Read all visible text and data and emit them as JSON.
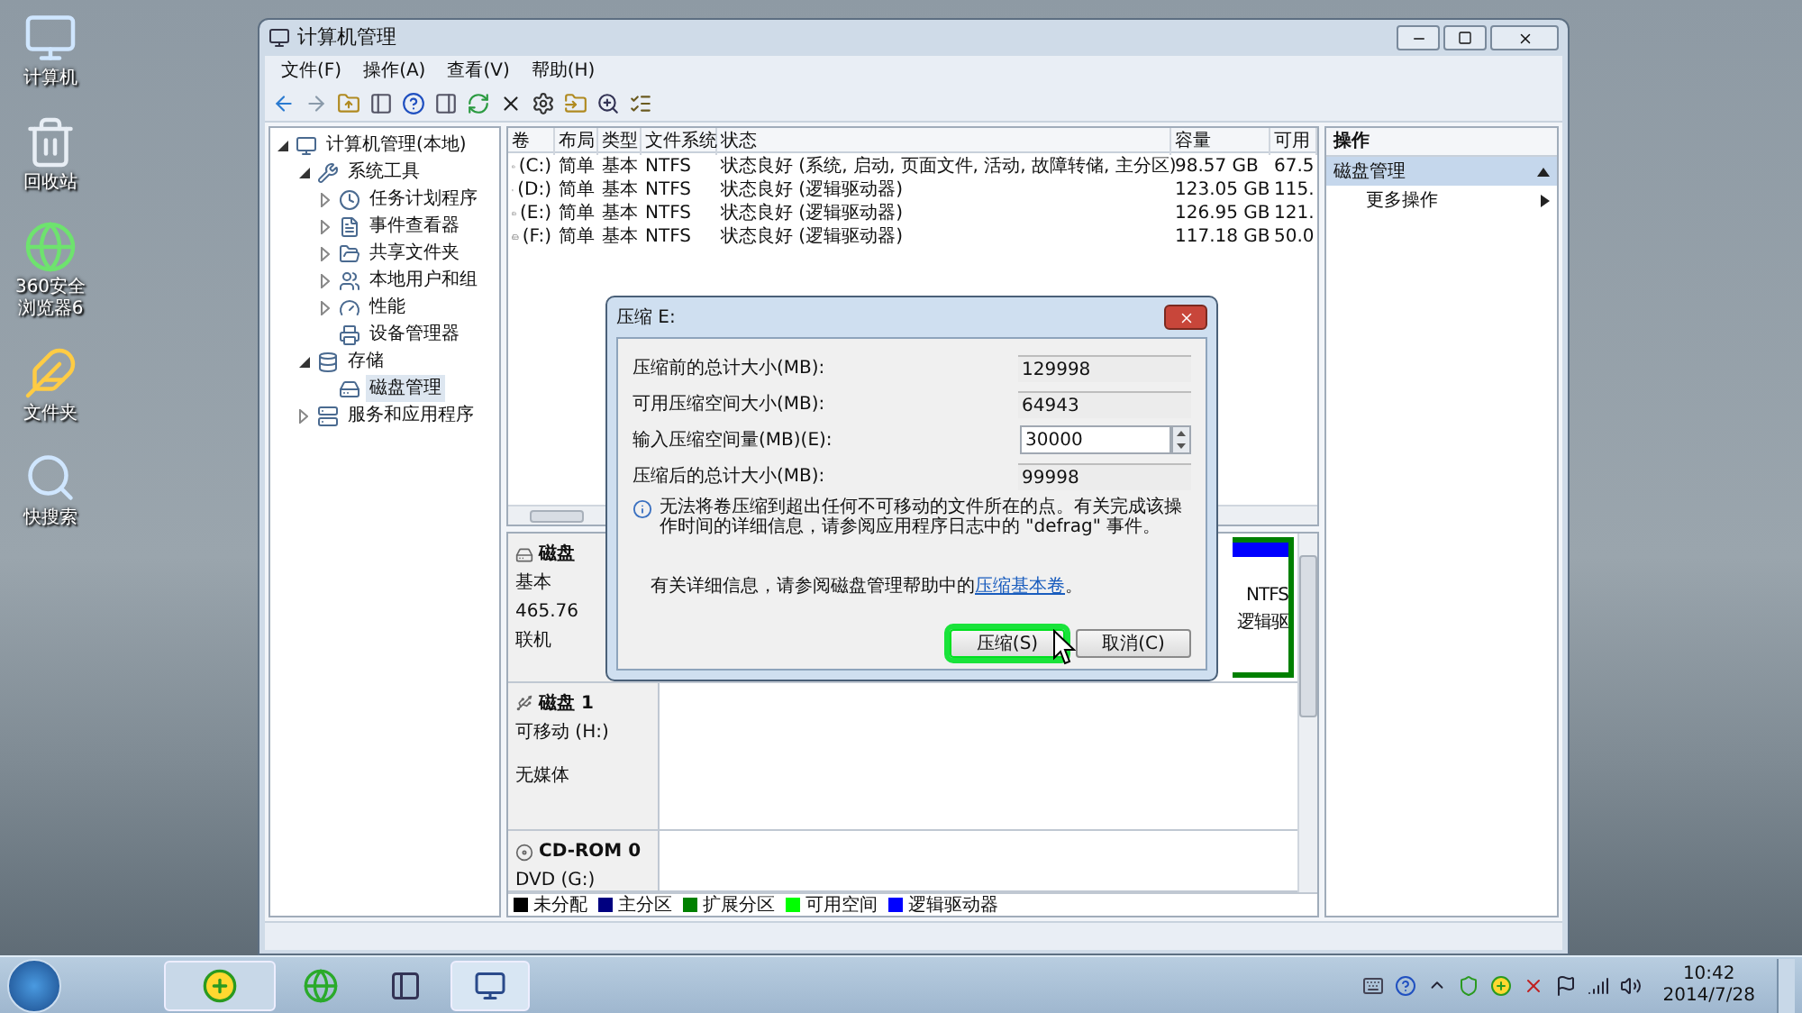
{
  "desktop_icons": [
    {
      "kind": "computer",
      "label": "计算机"
    },
    {
      "kind": "recycle",
      "label": "回收站"
    },
    {
      "kind": "browser",
      "label": "360安全浏览器6"
    },
    {
      "kind": "butterfly",
      "label": "文件夹"
    },
    {
      "kind": "search",
      "label": "快搜索"
    }
  ],
  "window": {
    "title": "计算机管理"
  },
  "menu": [
    "文件(F)",
    "操作(A)",
    "查看(V)",
    "帮助(H)"
  ],
  "tree": [
    {
      "kind": "computer",
      "label": "计算机管理(本地)",
      "expanded": true,
      "selected": false,
      "children": [
        {
          "kind": "tools",
          "label": "系统工具",
          "expanded": true,
          "selected": false,
          "children": [
            {
              "kind": "clock",
              "label": "任务计划程序",
              "expanded": false,
              "selected": false
            },
            {
              "kind": "log",
              "label": "事件查看器",
              "expanded": false,
              "selected": false
            },
            {
              "kind": "share",
              "label": "共享文件夹",
              "expanded": false,
              "selected": false
            },
            {
              "kind": "users",
              "label": "本地用户和组",
              "expanded": false,
              "selected": false
            },
            {
              "kind": "performance",
              "label": "性能",
              "expanded": false,
              "selected": false
            },
            {
              "kind": "devices",
              "label": "设备管理器",
              "selected": false
            }
          ]
        },
        {
          "kind": "storage",
          "label": "存储",
          "expanded": true,
          "selected": false,
          "children": [
            {
              "kind": "disk",
              "label": "磁盘管理",
              "selected": true
            }
          ]
        },
        {
          "kind": "services",
          "label": "服务和应用程序",
          "expanded": false,
          "selected": false
        }
      ]
    }
  ],
  "volumes": {
    "columns": [
      "卷",
      "布局",
      "类型",
      "文件系统",
      "状态",
      "容量",
      "可用"
    ],
    "rows": [
      {
        "volume": "(C:)",
        "layout": "简单",
        "type": "基本",
        "file_system": "NTFS",
        "status": "状态良好 (系统, 启动, 页面文件, 活动, 故障转储, 主分区)",
        "capacity": "98.57 GB",
        "free": "67.5"
      },
      {
        "volume": "(D:)",
        "layout": "简单",
        "type": "基本",
        "file_system": "NTFS",
        "status": "状态良好 (逻辑驱动器)",
        "capacity": "123.05 GB",
        "free": "115."
      },
      {
        "volume": "(E:)",
        "layout": "简单",
        "type": "基本",
        "file_system": "NTFS",
        "status": "状态良好 (逻辑驱动器)",
        "capacity": "126.95 GB",
        "free": "121."
      },
      {
        "volume": "(F:)",
        "layout": "简单",
        "type": "基本",
        "file_system": "NTFS",
        "status": "状态良好 (逻辑驱动器)",
        "capacity": "117.18 GB",
        "free": "50.0"
      }
    ]
  },
  "disks": [
    {
      "kind": "hdd",
      "name": "磁盘",
      "lines": [
        "基本",
        "465.76",
        "联机"
      ],
      "partition": {
        "file_system": "NTFS",
        "status": "逻辑驱"
      }
    },
    {
      "kind": "removable",
      "name": "磁盘 1",
      "lines": [
        "可移动 (H:)",
        "无媒体"
      ]
    },
    {
      "kind": "cdrom",
      "name": "CD-ROM 0",
      "lines": [
        "DVD (G:)"
      ]
    }
  ],
  "legend": [
    {
      "label": "未分配",
      "color": "#000000"
    },
    {
      "label": "主分区",
      "color": "#000080"
    },
    {
      "label": "扩展分区",
      "color": "#008000"
    },
    {
      "label": "可用空间",
      "color": "#00ff00"
    },
    {
      "label": "逻辑驱动器",
      "color": "#0000ff"
    }
  ],
  "actions": {
    "header": "操作",
    "section": {
      "label": "磁盘管理",
      "expanded": true
    },
    "items": [
      "更多操作"
    ]
  },
  "dialog": {
    "title": "压缩 E:",
    "fields": [
      {
        "kind": "readonly",
        "label": "压缩前的总计大小(MB):",
        "value": "129998"
      },
      {
        "kind": "readonly",
        "label": "可用压缩空间大小(MB):",
        "value": "64943"
      },
      {
        "kind": "spin",
        "label": "输入压缩空间量(MB)(E):",
        "value": "30000"
      },
      {
        "kind": "readonly",
        "label": "压缩后的总计大小(MB):",
        "value": "99998"
      }
    ],
    "note": "无法将卷压缩到超出任何不可移动的文件所在的点。有关完成该操作时间的详细信息，请参阅应用程序日志中的 \"defrag\" 事件。",
    "help_text": "有关详细信息，请参阅磁盘管理帮助中的",
    "help_link": "压缩基本卷",
    "help_end": "。",
    "buttons": [
      {
        "label": "压缩(S)",
        "highlighted": true
      },
      {
        "label": "取消(C)",
        "highlighted": false
      }
    ]
  },
  "clock": {
    "time": "10:42",
    "date": "2014/7/28"
  }
}
